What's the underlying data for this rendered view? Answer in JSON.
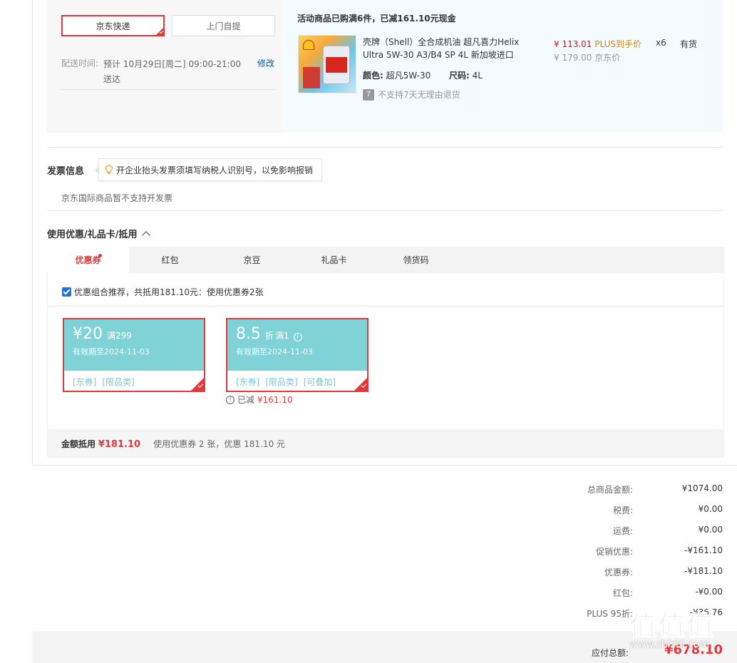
{
  "delivery": {
    "buttons": [
      "京东快递",
      "上门自提"
    ],
    "time_label": "配送时间:",
    "time_value": "预计 10月29日[周二] 09:00-21:00 送达",
    "edit": "修改"
  },
  "product": {
    "promo_title": "活动商品已购满6件，已减161.10元现金",
    "name": "壳牌（Shell）全合成机油 超凡喜力Helix Ultra 5W-30 A3/B4 SP 4L 新加坡进口",
    "color_label": "颜色:",
    "color_value": "超凡5W-30",
    "size_label": "尺码:",
    "size_value": "4L",
    "no_return_badge": "7",
    "no_return": "不支持7天无理由退货",
    "price_plus": "¥ 113.01",
    "price_plus_suffix": "PLUS到手价",
    "price_jd": "¥ 179.00 京东价",
    "qty": "x6",
    "stock": "有货"
  },
  "invoice": {
    "title": "发票信息",
    "tip": "开企业抬头发票须填写纳税人识别号，以免影响报销",
    "note": "京东国际商品暂不支持开发票"
  },
  "coupon_section": {
    "title": "使用优惠/礼品卡/抵用",
    "tabs": [
      "优惠券",
      "红包",
      "京豆",
      "礼品卡",
      "领货码"
    ],
    "combo_check": "优惠组合推荐，共抵用181.10元：使用优惠券2张",
    "coupons": [
      {
        "amount": "¥20",
        "cond": "满299",
        "valid": "有效期至2024-11-03",
        "tags": [
          "[东券]",
          "[限品类]"
        ]
      },
      {
        "amount": "8.5",
        "unit": "折",
        "cond": "满1",
        "valid": "有效期至2024-11-03",
        "tags": [
          "[东券]",
          "[限品类]",
          "[可叠加]"
        ]
      }
    ],
    "coupon2_used_label": "已减",
    "coupon2_used_value": "¥161.10",
    "sum_label": "金额抵用",
    "sum_value": "¥181.10",
    "sum_desc": "使用优惠券 2 张，优惠 181.10 元"
  },
  "totals": [
    {
      "k": "总商品金额:",
      "v": "¥1074.00"
    },
    {
      "k": "税费:",
      "v": "¥0.00"
    },
    {
      "k": "运费:",
      "v": "¥0.00"
    },
    {
      "k": "促销优惠:",
      "v": "-¥161.10"
    },
    {
      "k": "优惠券:",
      "v": "-¥181.10"
    },
    {
      "k": "红包:",
      "v": "-¥0.00"
    },
    {
      "k": "PLUS 95折:",
      "v": "-¥36.76"
    }
  ],
  "pay": {
    "label": "应付总额:",
    "value": "¥678.10"
  },
  "watermark": {
    "glyphs": "值值值",
    "url": "www.zhizhi.com"
  }
}
